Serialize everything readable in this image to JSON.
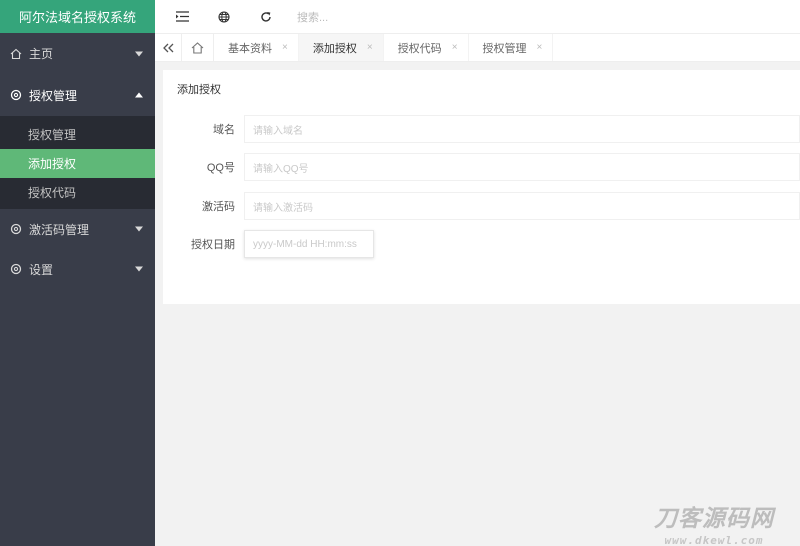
{
  "sidebar": {
    "logo": "阿尔法域名授权系统",
    "items": [
      {
        "label": "主页",
        "icon": "home-icon",
        "expanded": false
      },
      {
        "label": "授权管理",
        "icon": "gear-icon",
        "expanded": true,
        "children": [
          {
            "label": "授权管理",
            "active": false
          },
          {
            "label": "添加授权",
            "active": true
          },
          {
            "label": "授权代码",
            "active": false
          }
        ]
      },
      {
        "label": "激活码管理",
        "icon": "gear-icon",
        "expanded": false
      },
      {
        "label": "设置",
        "icon": "gear-icon",
        "expanded": false
      }
    ]
  },
  "topbar": {
    "icons": [
      "menu-toggle-icon",
      "globe-icon",
      "refresh-icon"
    ],
    "search_text": "搜索..."
  },
  "tabs": {
    "items": [
      {
        "label": "基本资料",
        "active": false
      },
      {
        "label": "添加授权",
        "active": true
      },
      {
        "label": "授权代码",
        "active": false
      },
      {
        "label": "授权管理",
        "active": false
      }
    ],
    "close_glyph": "×"
  },
  "form": {
    "title": "添加授权",
    "fields": [
      {
        "label": "域名",
        "placeholder": "请输入域名"
      },
      {
        "label": "QQ号",
        "placeholder": "请输入QQ号"
      },
      {
        "label": "激活码",
        "placeholder": "请输入激活码"
      },
      {
        "label": "授权日期",
        "placeholder": "yyyy-MM-dd HH:mm:ss"
      }
    ]
  },
  "watermark": {
    "main": "刀客源码网",
    "sub": "www.dkewl.com"
  },
  "colors": {
    "sidebar_bg": "#393D49",
    "logo_bg": "#35A57B",
    "active_green": "#5FB878",
    "submenu_bg": "#282B33"
  }
}
